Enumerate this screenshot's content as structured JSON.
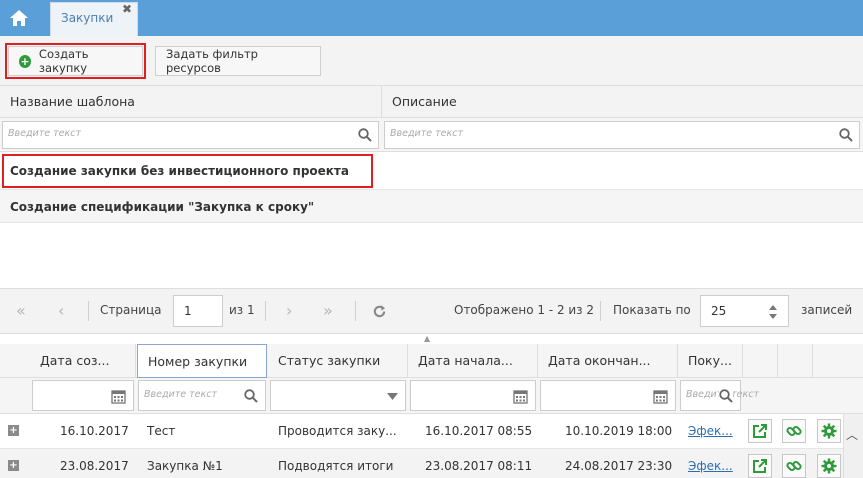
{
  "tabs": {
    "active_tab_label": "Закупки",
    "close_glyph": "✖"
  },
  "toolbar": {
    "create_label": "Создать закупку",
    "filter_label": "Задать фильтр ресурсов"
  },
  "templates": {
    "columns": [
      "Название шаблона",
      "Описание"
    ],
    "filter_placeholder": "Введите текст",
    "rows": [
      {
        "name": "Создание закупки без инвестиционного проекта",
        "description": ""
      },
      {
        "name": "Создание спецификации \"Закупка к сроку\"",
        "description": ""
      }
    ]
  },
  "pager": {
    "page_label": "Страница",
    "page_value": "1",
    "of_label": "из 1",
    "shown_label": "Отображено 1 - 2 из 2",
    "show_by_label": "Показать по",
    "page_size": "25",
    "records_label": "записей"
  },
  "procurements": {
    "columns": [
      "Дата соз...",
      "Номер закупки",
      "Статус закупки",
      "Дата начала...",
      "Дата окончан...",
      "Поку..."
    ],
    "filter_placeholder": "Введите текст",
    "rows": [
      {
        "created": "16.10.2017",
        "number": "Тест",
        "status": "Проводится заку...",
        "start": "16.10.2017 08:55",
        "end": "10.10.2019 18:00",
        "buyer": "Эфек..."
      },
      {
        "created": "23.08.2017",
        "number": "Закупка №1",
        "status": "Подводятся итоги",
        "start": "23.08.2017 08:11",
        "end": "24.08.2017 23:30",
        "buyer": "Эфек..."
      }
    ]
  },
  "colors": {
    "topbar": "#5b9fd8",
    "highlight": "#e02020",
    "create_icon": "#2e9a3a",
    "action_icon": "#2e9a3a",
    "link": "#2a6fb5"
  },
  "icons": [
    "home-icon",
    "close-icon",
    "plus-circle-icon",
    "search-icon",
    "calendar-icon",
    "chevron-down-icon",
    "external-link-icon",
    "link-icon",
    "gear-icon",
    "refresh-icon"
  ]
}
